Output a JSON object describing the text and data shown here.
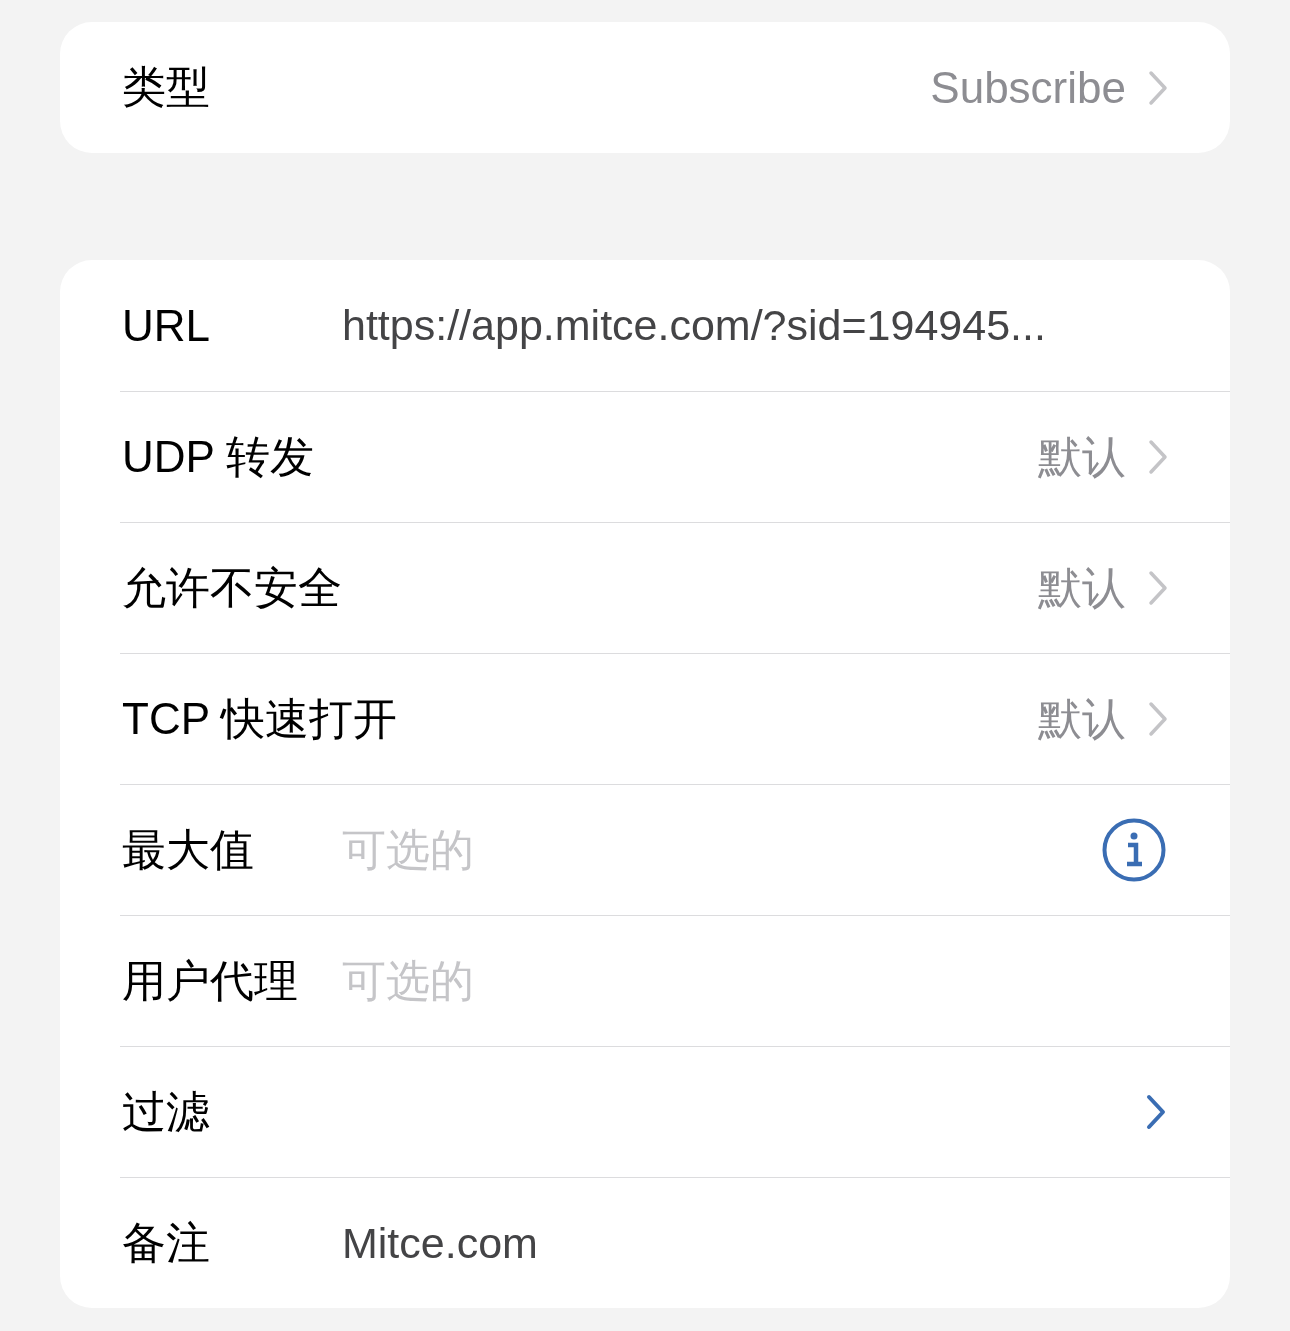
{
  "type_card": {
    "label": "类型",
    "value": "Subscribe"
  },
  "rows": [
    {
      "kind": "text",
      "label": "URL",
      "value": "https://app.mitce.com/?sid=194945..."
    },
    {
      "kind": "option",
      "label": "UDP 转发",
      "value": "默认"
    },
    {
      "kind": "option",
      "label": "允许不安全",
      "value": "默认"
    },
    {
      "kind": "option",
      "label": "TCP 快速打开",
      "value": "默认"
    },
    {
      "kind": "field",
      "label": "最大值",
      "placeholder": "可选的",
      "info": true
    },
    {
      "kind": "field",
      "label": "用户代理",
      "placeholder": "可选的",
      "info": false
    },
    {
      "kind": "link",
      "label": "过滤"
    },
    {
      "kind": "text",
      "label": "备注",
      "value": "Mitce.com"
    }
  ]
}
